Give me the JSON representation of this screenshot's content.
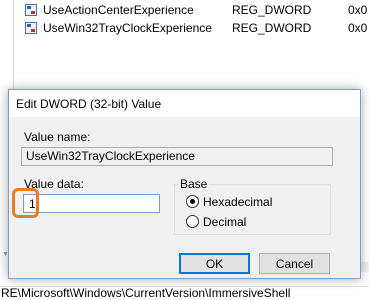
{
  "registry": {
    "values": [
      {
        "name": "UseActionCenterExperience",
        "type": "REG_DWORD",
        "data": "0x0"
      },
      {
        "name": "UseWin32TrayClockExperience",
        "type": "REG_DWORD",
        "data": "0x0"
      }
    ],
    "status_path": "RE\\Microsoft\\Windows\\CurrentVersion\\ImmersiveShell"
  },
  "dialog": {
    "title": "Edit DWORD (32-bit) Value",
    "value_name_label": "Value name:",
    "value_name": "UseWin32TrayClockExperience",
    "value_data_label": "Value data:",
    "value_data": "1",
    "base_label": "Base",
    "base_options": [
      "Hexadecimal",
      "Decimal"
    ],
    "selected_base": "Hexadecimal",
    "ok_label": "OK",
    "cancel_label": "Cancel"
  },
  "colors": {
    "highlight": "#e77b2a",
    "dialog_border": "#7a9ec9",
    "dialog_bg": "#f0f0f0"
  },
  "icons": {
    "registry_value": "reg-binary-value-icon",
    "scroll_arrow": "scroll-down-arrow-icon"
  }
}
